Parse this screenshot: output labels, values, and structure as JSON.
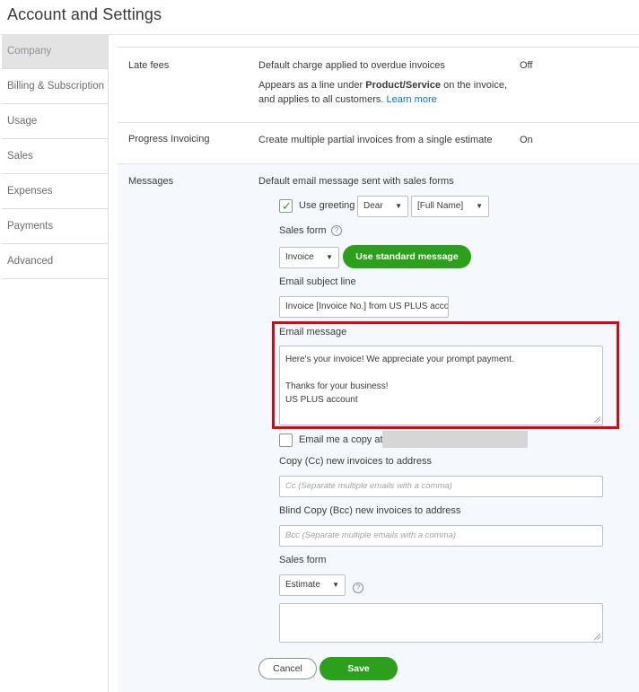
{
  "header": {
    "title": "Account and Settings"
  },
  "sidebar": {
    "items": [
      {
        "label": "Company",
        "active": true
      },
      {
        "label": "Billing & Subscription"
      },
      {
        "label": "Usage"
      },
      {
        "label": "Sales"
      },
      {
        "label": "Expenses"
      },
      {
        "label": "Payments"
      },
      {
        "label": "Advanced"
      }
    ]
  },
  "late_fees": {
    "label": "Late fees",
    "description": "Default charge applied to overdue invoices",
    "value": "Off",
    "note_prefix": "Appears as a line under ",
    "note_bold": "Product/Service",
    "note_suffix": " on the invoice,",
    "note_line2": "and applies to all customers.",
    "learn_more": "Learn more"
  },
  "progress_invoicing": {
    "label": "Progress Invoicing",
    "description": "Create multiple partial invoices from a single estimate",
    "value": "On"
  },
  "messages": {
    "label": "Messages",
    "description": "Default email message sent with sales forms",
    "use_greeting_label": "Use greeting",
    "use_greeting_checked": true,
    "greeting_select": "Dear",
    "name_select": "[Full Name]",
    "sales_form_label": "Sales form",
    "sales_form_select": "Invoice",
    "use_standard_button": "Use standard message",
    "subject_label": "Email subject line",
    "subject_value": "Invoice [Invoice No.] from US PLUS acco",
    "email_message_label": "Email message",
    "email_message_lines": [
      "Here's your invoice! We appreciate your prompt payment.",
      "",
      "Thanks for your business!",
      "US PLUS account"
    ],
    "email_copy_label": "Email me a copy at",
    "email_copy_checked": false,
    "cc_label": "Copy (Cc) new invoices to address",
    "cc_placeholder": "Cc (Separate multiple emails with a comma)",
    "bcc_label": "Blind Copy (Bcc) new invoices to address",
    "bcc_placeholder": "Bcc (Separate multiple emails with a comma)",
    "sales_form2_label": "Sales form",
    "sales_form2_select": "Estimate"
  },
  "actions": {
    "cancel": "Cancel",
    "save": "Save"
  },
  "colors": {
    "accent_green": "#2ca01c",
    "link_blue": "#0077c5",
    "highlight_red": "#e3000f"
  }
}
